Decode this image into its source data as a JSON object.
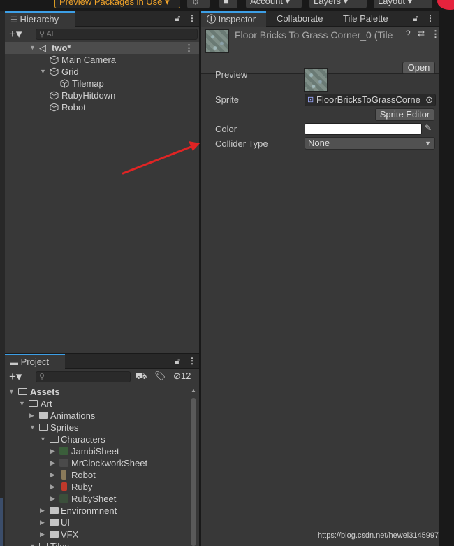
{
  "toolbar": {
    "preview_packages": "Preview Packages in Use ▾",
    "account": "Account",
    "layers": "Layers",
    "layout": "Layout"
  },
  "hierarchy": {
    "tab_label": "Hierarchy",
    "search_placeholder": "All",
    "scene": "two*",
    "items": [
      {
        "label": "Main Camera"
      },
      {
        "label": "Grid"
      },
      {
        "label": "Tilemap"
      },
      {
        "label": "RubyHitdown"
      },
      {
        "label": "Robot"
      }
    ]
  },
  "inspector": {
    "tabs": [
      "Inspector",
      "Collaborate",
      "Tile Palette"
    ],
    "asset_title": "Floor Bricks To Grass Corner_0 (Tile",
    "open_label": "Open",
    "preview_label": "Preview",
    "sprite_label": "Sprite",
    "sprite_value": "FloorBricksToGrassCorne",
    "sprite_editor_label": "Sprite Editor",
    "color_label": "Color",
    "color_value": "#ffffff",
    "collider_label": "Collider Type",
    "collider_value": "None"
  },
  "project": {
    "tab_label": "Project",
    "hidden_count": "12",
    "tree": [
      {
        "label": "Assets"
      },
      {
        "label": "Art"
      },
      {
        "label": "Animations"
      },
      {
        "label": "Sprites"
      },
      {
        "label": "Characters"
      },
      {
        "label": "JambiSheet"
      },
      {
        "label": "MrClockworkSheet"
      },
      {
        "label": "Robot"
      },
      {
        "label": "Ruby"
      },
      {
        "label": "RubySheet"
      },
      {
        "label": "Environmnent"
      },
      {
        "label": "UI"
      },
      {
        "label": "VFX"
      },
      {
        "label": "Tiles"
      }
    ]
  },
  "watermark": "https://blog.csdn.net/hewei3145997",
  "colors": {
    "accent": "#3d9fe6",
    "annotation_arrow": "#e02424",
    "warning": "#f0a32a"
  }
}
